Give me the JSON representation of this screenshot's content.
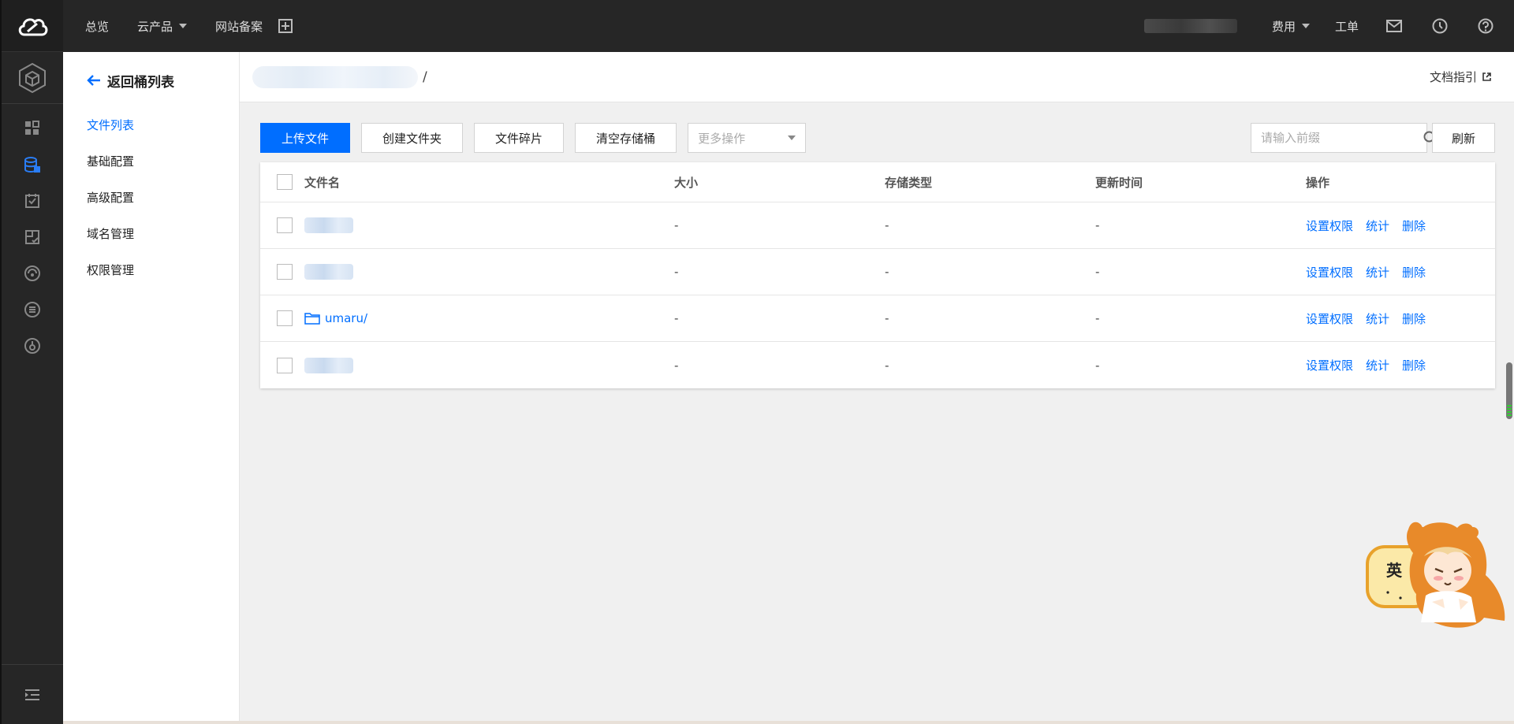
{
  "topbar": {
    "nav": [
      {
        "label": "总览"
      },
      {
        "label": "云产品"
      },
      {
        "label": "网站备案"
      }
    ],
    "right": {
      "fees_label": "费用",
      "ticket_label": "工单"
    }
  },
  "sidebar": {
    "back_label": "返回桶列表",
    "items": [
      {
        "label": "文件列表",
        "active": true
      },
      {
        "label": "基础配置"
      },
      {
        "label": "高级配置"
      },
      {
        "label": "域名管理"
      },
      {
        "label": "权限管理"
      }
    ]
  },
  "header": {
    "path_separator": "/",
    "doc_link": "文档指引"
  },
  "toolbar": {
    "upload_label": "上传文件",
    "new_folder_label": "创建文件夹",
    "fragments_label": "文件碎片",
    "empty_bucket_label": "清空存储桶",
    "more_actions_label": "更多操作",
    "search_placeholder": "请输入前缀",
    "refresh_label": "刷新"
  },
  "table": {
    "columns": [
      "文件名",
      "大小",
      "存储类型",
      "更新时间",
      "操作"
    ],
    "actions": [
      "设置权限",
      "统计",
      "删除"
    ],
    "rows": [
      {
        "name": "",
        "size": "-",
        "storage": "-",
        "updated": "-"
      },
      {
        "name": "",
        "size": "-",
        "storage": "-",
        "updated": "-"
      },
      {
        "name": "umaru/",
        "size": "-",
        "storage": "-",
        "updated": "-"
      },
      {
        "name": "",
        "size": "-",
        "storage": "-",
        "updated": "-"
      }
    ]
  },
  "mascot": {
    "bubble_text": "英"
  },
  "colors": {
    "accent": "#006eff",
    "topbar": "#262626",
    "rail": "#262626"
  }
}
